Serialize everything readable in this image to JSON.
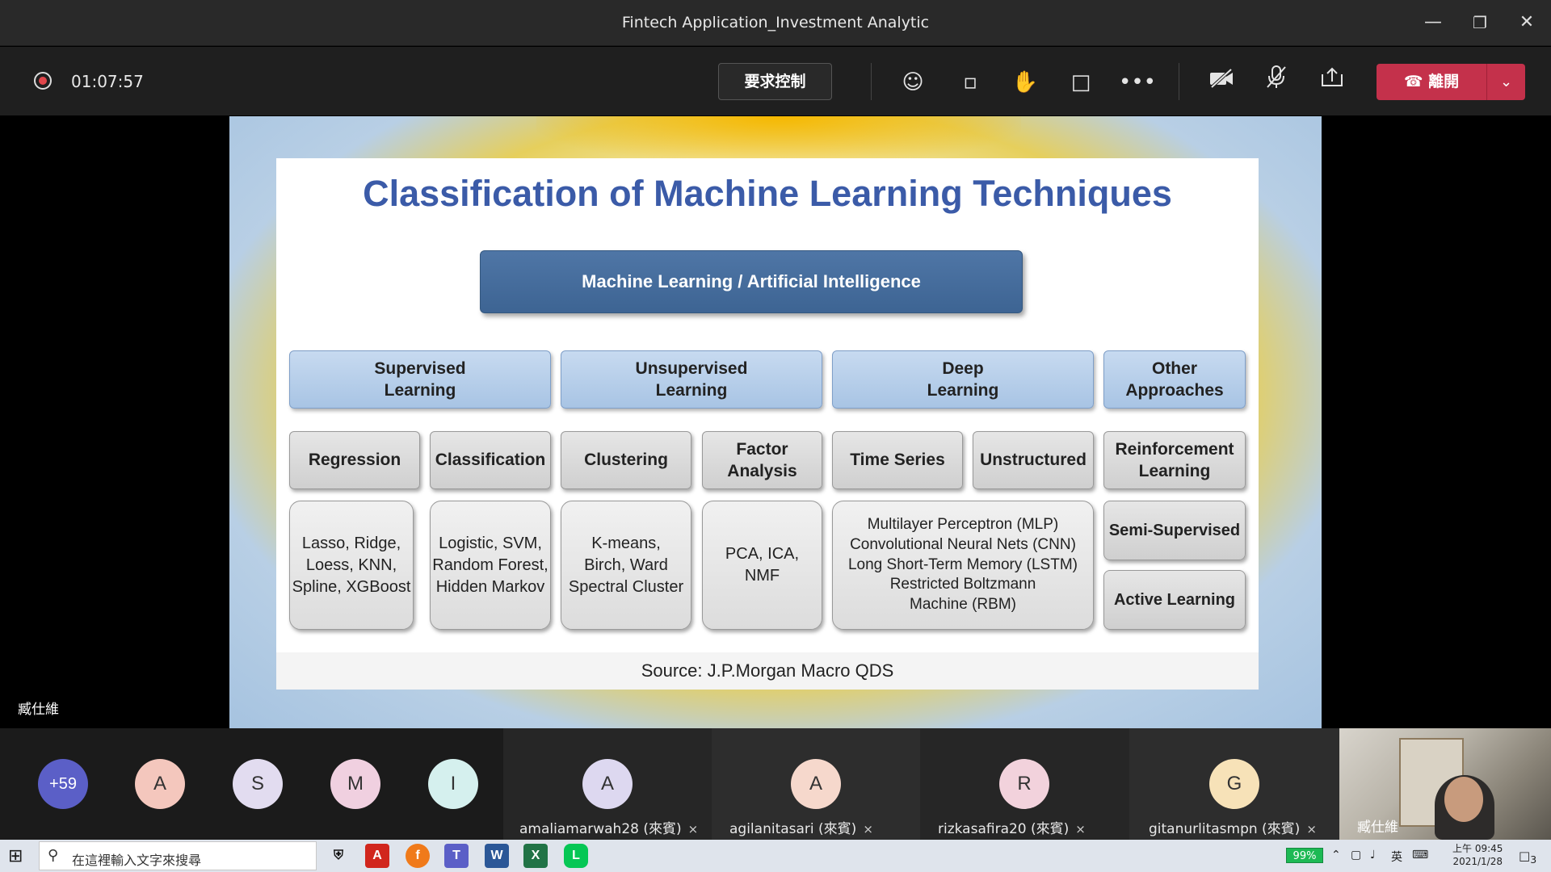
{
  "window": {
    "title": "Fintech Application_Investment Analytic"
  },
  "toolbar": {
    "timer": "01:07:57",
    "request_control": "要求控制",
    "leave_label": "離開"
  },
  "slide": {
    "title": "Classification of Machine Learning Techniques",
    "root": "Machine Learning / Artificial  Intelligence",
    "categories": [
      "Supervised\nLearning",
      "Unsupervised\nLearning",
      "Deep\nLearning",
      "Other\nApproaches"
    ],
    "subcategories": [
      "Regression",
      "Classification",
      "Clustering",
      "Factor\nAnalysis",
      "Time Series",
      "Unstructured",
      "Reinforcement\nLearning"
    ],
    "details": [
      "Lasso, Ridge,\nLoess, KNN,\nSpline, XGBoost",
      "Logistic, SVM,\nRandom Forest,\nHidden Markov",
      "K-means,\nBirch, Ward\nSpectral Cluster",
      "PCA, ICA,\nNMF",
      "Multilayer  Perceptron (MLP)\nConvolutional  Neural Nets (CNN)\nLong Short-Term Memory (LSTM)\nRestricted Boltzmann\nMachine (RBM)"
    ],
    "other_items": [
      "Semi-Supervised",
      "Active Learning"
    ],
    "source": "Source: J.P.Morgan Macro QDS"
  },
  "presenter": {
    "name": "臧仕維"
  },
  "participants": {
    "overflow": "+59",
    "avatars": [
      {
        "initial": "A",
        "color": "#f4c7bd"
      },
      {
        "initial": "S",
        "color": "#e2dcf0"
      },
      {
        "initial": "M",
        "color": "#f0d0e0"
      },
      {
        "initial": "I",
        "color": "#d5f0ee"
      }
    ],
    "named": [
      {
        "initial": "A",
        "name": "amaliamarwah28 (來賓)",
        "color": "#ddd8f0"
      },
      {
        "initial": "A",
        "name": "agilanitasari (來賓)",
        "color": "#f6d8cc"
      },
      {
        "initial": "R",
        "name": "rizkasafira20 (來賓)",
        "color": "#f2d2dc"
      },
      {
        "initial": "G",
        "name": "gitanurlitasmpn (來賓)",
        "color": "#f7e2b8"
      }
    ],
    "video_name": "臧仕維"
  },
  "taskbar": {
    "search_placeholder": "在這裡輸入文字來搜尋",
    "battery": "99%",
    "ime": "英",
    "time": "上午 09:45",
    "date": "2021/1/28",
    "notifications": "3"
  }
}
